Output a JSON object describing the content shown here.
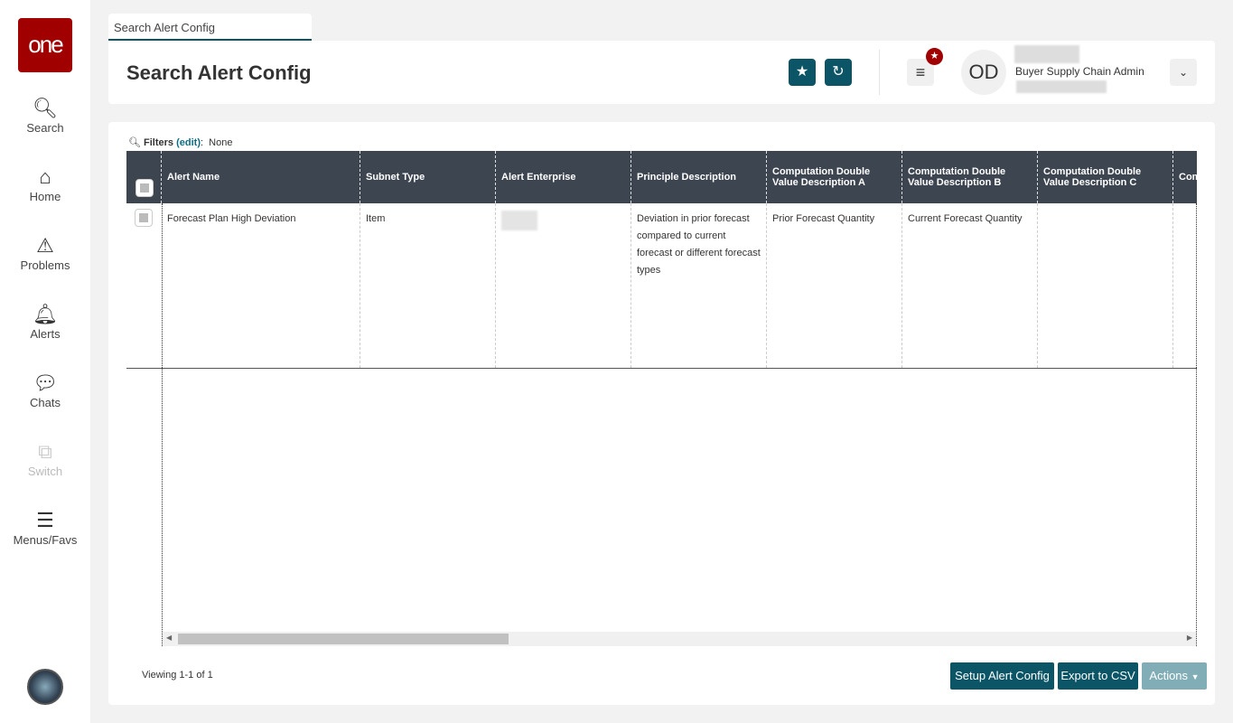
{
  "sidebar": {
    "logo": "one",
    "items": [
      {
        "label": "Search",
        "icon": "search-icon"
      },
      {
        "label": "Home",
        "icon": "home-icon"
      },
      {
        "label": "Problems",
        "icon": "warning-icon"
      },
      {
        "label": "Alerts",
        "icon": "bell-icon"
      },
      {
        "label": "Chats",
        "icon": "chat-icon"
      },
      {
        "label": "Switch",
        "icon": "switch-icon"
      },
      {
        "label": "Menus/Favs",
        "icon": "menu-icon"
      }
    ]
  },
  "tab": {
    "label": "Search Alert Config"
  },
  "header": {
    "title": "Search Alert Config",
    "user_initials": "OD",
    "user_role": "Buyer Supply Chain Admin"
  },
  "filters": {
    "label": "Filters",
    "edit": "(edit)",
    "value": "None"
  },
  "table": {
    "columns": [
      "Alert Name",
      "Subnet Type",
      "Alert Enterprise",
      "Principle Description",
      "Computation Double Value Description A",
      "Computation Double Value Description B",
      "Computation Double Value Description C",
      "Computation Double Value"
    ],
    "rows": [
      {
        "alert_name": "Forecast Plan High Deviation",
        "subnet_type": "Item",
        "alert_enterprise": "",
        "principle_description": "Deviation in prior forecast compared to current forecast or different forecast types",
        "desc_a": "Prior Forecast Quantity",
        "desc_b": "Current Forecast Quantity",
        "desc_c": "",
        "desc_d": ""
      }
    ]
  },
  "footer": {
    "viewing": "Viewing 1-1 of 1",
    "setup": "Setup Alert Config",
    "export": "Export to CSV",
    "actions": "Actions"
  }
}
